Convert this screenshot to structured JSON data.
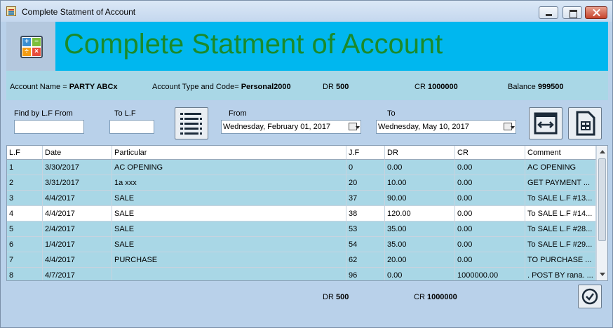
{
  "window": {
    "title": "Complete Statment of Account"
  },
  "banner": {
    "title": "Complete Statment of Account"
  },
  "account": {
    "name_label": "Account Name =",
    "name_value": "PARTY ABCx",
    "type_label": "Account Type and Code=",
    "type_value": "Personal2000",
    "dr_label": "DR",
    "dr_value": "500",
    "cr_label": "CR",
    "cr_value": "1000000",
    "balance_label": "Balance",
    "balance_value": "999500"
  },
  "filters": {
    "lf_from_label": "Find by L.F From",
    "lf_from_value": "",
    "lf_to_label": "To L.F",
    "lf_to_value": "",
    "from_label": "From",
    "from_date": "Wednesday,   February  01, 2017",
    "to_label": "To",
    "to_date": "Wednesday,      May       10, 2017"
  },
  "table": {
    "columns": [
      "L.F",
      "Date",
      "Particular",
      "J.F",
      "DR",
      "CR",
      "Comment"
    ],
    "rows": [
      [
        "1",
        "3/30/2017",
        "AC OPENING",
        "0",
        "0.00",
        "0.00",
        "AC OPENING"
      ],
      [
        "2",
        "3/31/2017",
        "1a xxx",
        "20",
        "10.00",
        "0.00",
        "GET PAYMENT ..."
      ],
      [
        "3",
        "4/4/2017",
        "SALE",
        "37",
        "90.00",
        "0.00",
        "To SALE L.F #13..."
      ],
      [
        "4",
        "4/4/2017",
        "SALE",
        "38",
        "120.00",
        "0.00",
        "To SALE L.F #14..."
      ],
      [
        "5",
        "2/4/2017",
        "SALE",
        "53",
        "35.00",
        "0.00",
        "To SALE L.F #28..."
      ],
      [
        "6",
        "1/4/2017",
        "SALE",
        "54",
        "35.00",
        "0.00",
        "To SALE L.F #29..."
      ],
      [
        "7",
        "4/4/2017",
        "PURCHASE",
        "62",
        "20.00",
        "0.00",
        "TO PURCHASE ..."
      ],
      [
        "8",
        "4/7/2017",
        "",
        "96",
        "0.00",
        "1000000.00",
        ". POST BY rana. ..."
      ]
    ],
    "selected_row": 3
  },
  "totals": {
    "dr_label": "DR",
    "dr_value": "500",
    "cr_label": "CR",
    "cr_value": "1000000"
  },
  "colors": {
    "banner_bg": "#00b7ef",
    "banner_text": "#1b8a2a",
    "row_bg": "#a9d7e6",
    "window_bg": "#b9d1ea"
  },
  "icons": {
    "app": "app-icon",
    "banner": "calculator-icon",
    "list": "list-icon",
    "expand": "expand-width-icon",
    "export": "spreadsheet-icon",
    "ok": "check-circle-icon"
  }
}
